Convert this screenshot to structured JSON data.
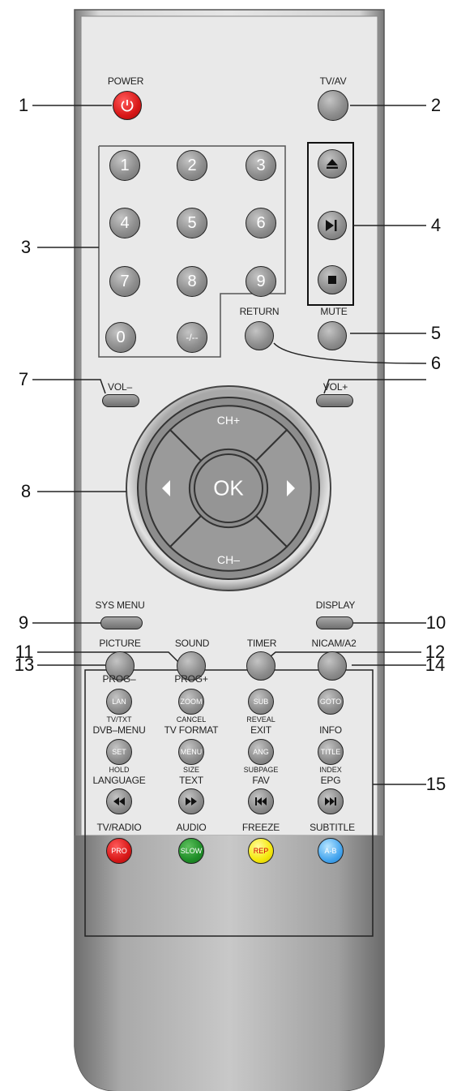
{
  "callouts": [
    "1",
    "2",
    "3",
    "4",
    "5",
    "6",
    "7",
    "8",
    "9",
    "10",
    "11",
    "12",
    "13",
    "14",
    "15"
  ],
  "top": {
    "power": "POWER",
    "tvav": "TV/AV"
  },
  "digits": [
    "1",
    "2",
    "3",
    "4",
    "5",
    "6",
    "7",
    "8",
    "9",
    "0",
    "-/--"
  ],
  "labels": {
    "return": "RETURN",
    "mute": "MUTE",
    "vol_minus": "VOL–",
    "vol_plus": "VOL+",
    "ch_plus": "CH+",
    "ch_minus": "CH–",
    "ok": "OK",
    "sys_menu": "SYS MENU",
    "display": "DISPLAY",
    "picture": "PICTURE",
    "sound": "SOUND",
    "timer": "TIMER",
    "nicam": "NICAM/A2"
  },
  "grid": {
    "row1_top": [
      "PROG–",
      "PROG+",
      "",
      ""
    ],
    "row1_btn": [
      "LAN",
      "ZOOM",
      "SUB",
      "GOTO"
    ],
    "row2_small": [
      "TV/TXT",
      "CANCEL",
      "REVEAL",
      ""
    ],
    "row2_top": [
      "DVB–MENU",
      "TV FORMAT",
      "EXIT",
      "INFO"
    ],
    "row2_btn": [
      "SET",
      "MENU",
      "ANG",
      "TITLE"
    ],
    "row3_small": [
      "HOLD",
      "SIZE",
      "SUBPAGE",
      "INDEX"
    ],
    "row3_top": [
      "LANGUAGE",
      "TEXT",
      "FAV",
      "EPG"
    ],
    "row4_top": [
      "TV/RADIO",
      "AUDIO",
      "FREEZE",
      "SUBTITLE"
    ],
    "row4_btn": [
      "PRO",
      "SLOW",
      "REP",
      "A-B"
    ]
  }
}
